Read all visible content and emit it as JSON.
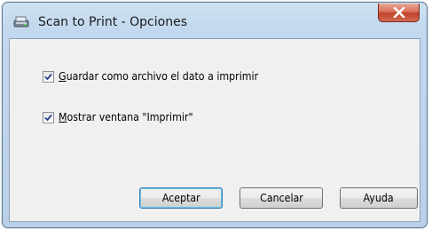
{
  "window": {
    "title": "Scan to Print - Opciones",
    "icons": {
      "app": "scanner-printer-icon",
      "close": "close-x-icon"
    }
  },
  "options": [
    {
      "label": "Guardar como archivo el dato a imprimir",
      "checked": true,
      "mnemonic": "G"
    },
    {
      "label": "Mostrar ventana \"Imprimir\"",
      "checked": true,
      "mnemonic": "M"
    }
  ],
  "buttons": {
    "ok": "Aceptar",
    "cancel": "Cancelar",
    "help": "Ayuda"
  },
  "colors": {
    "close_button": "#c9553e",
    "titlebar": "#c3d8ee",
    "default_button_border": "#3c7fb1"
  }
}
